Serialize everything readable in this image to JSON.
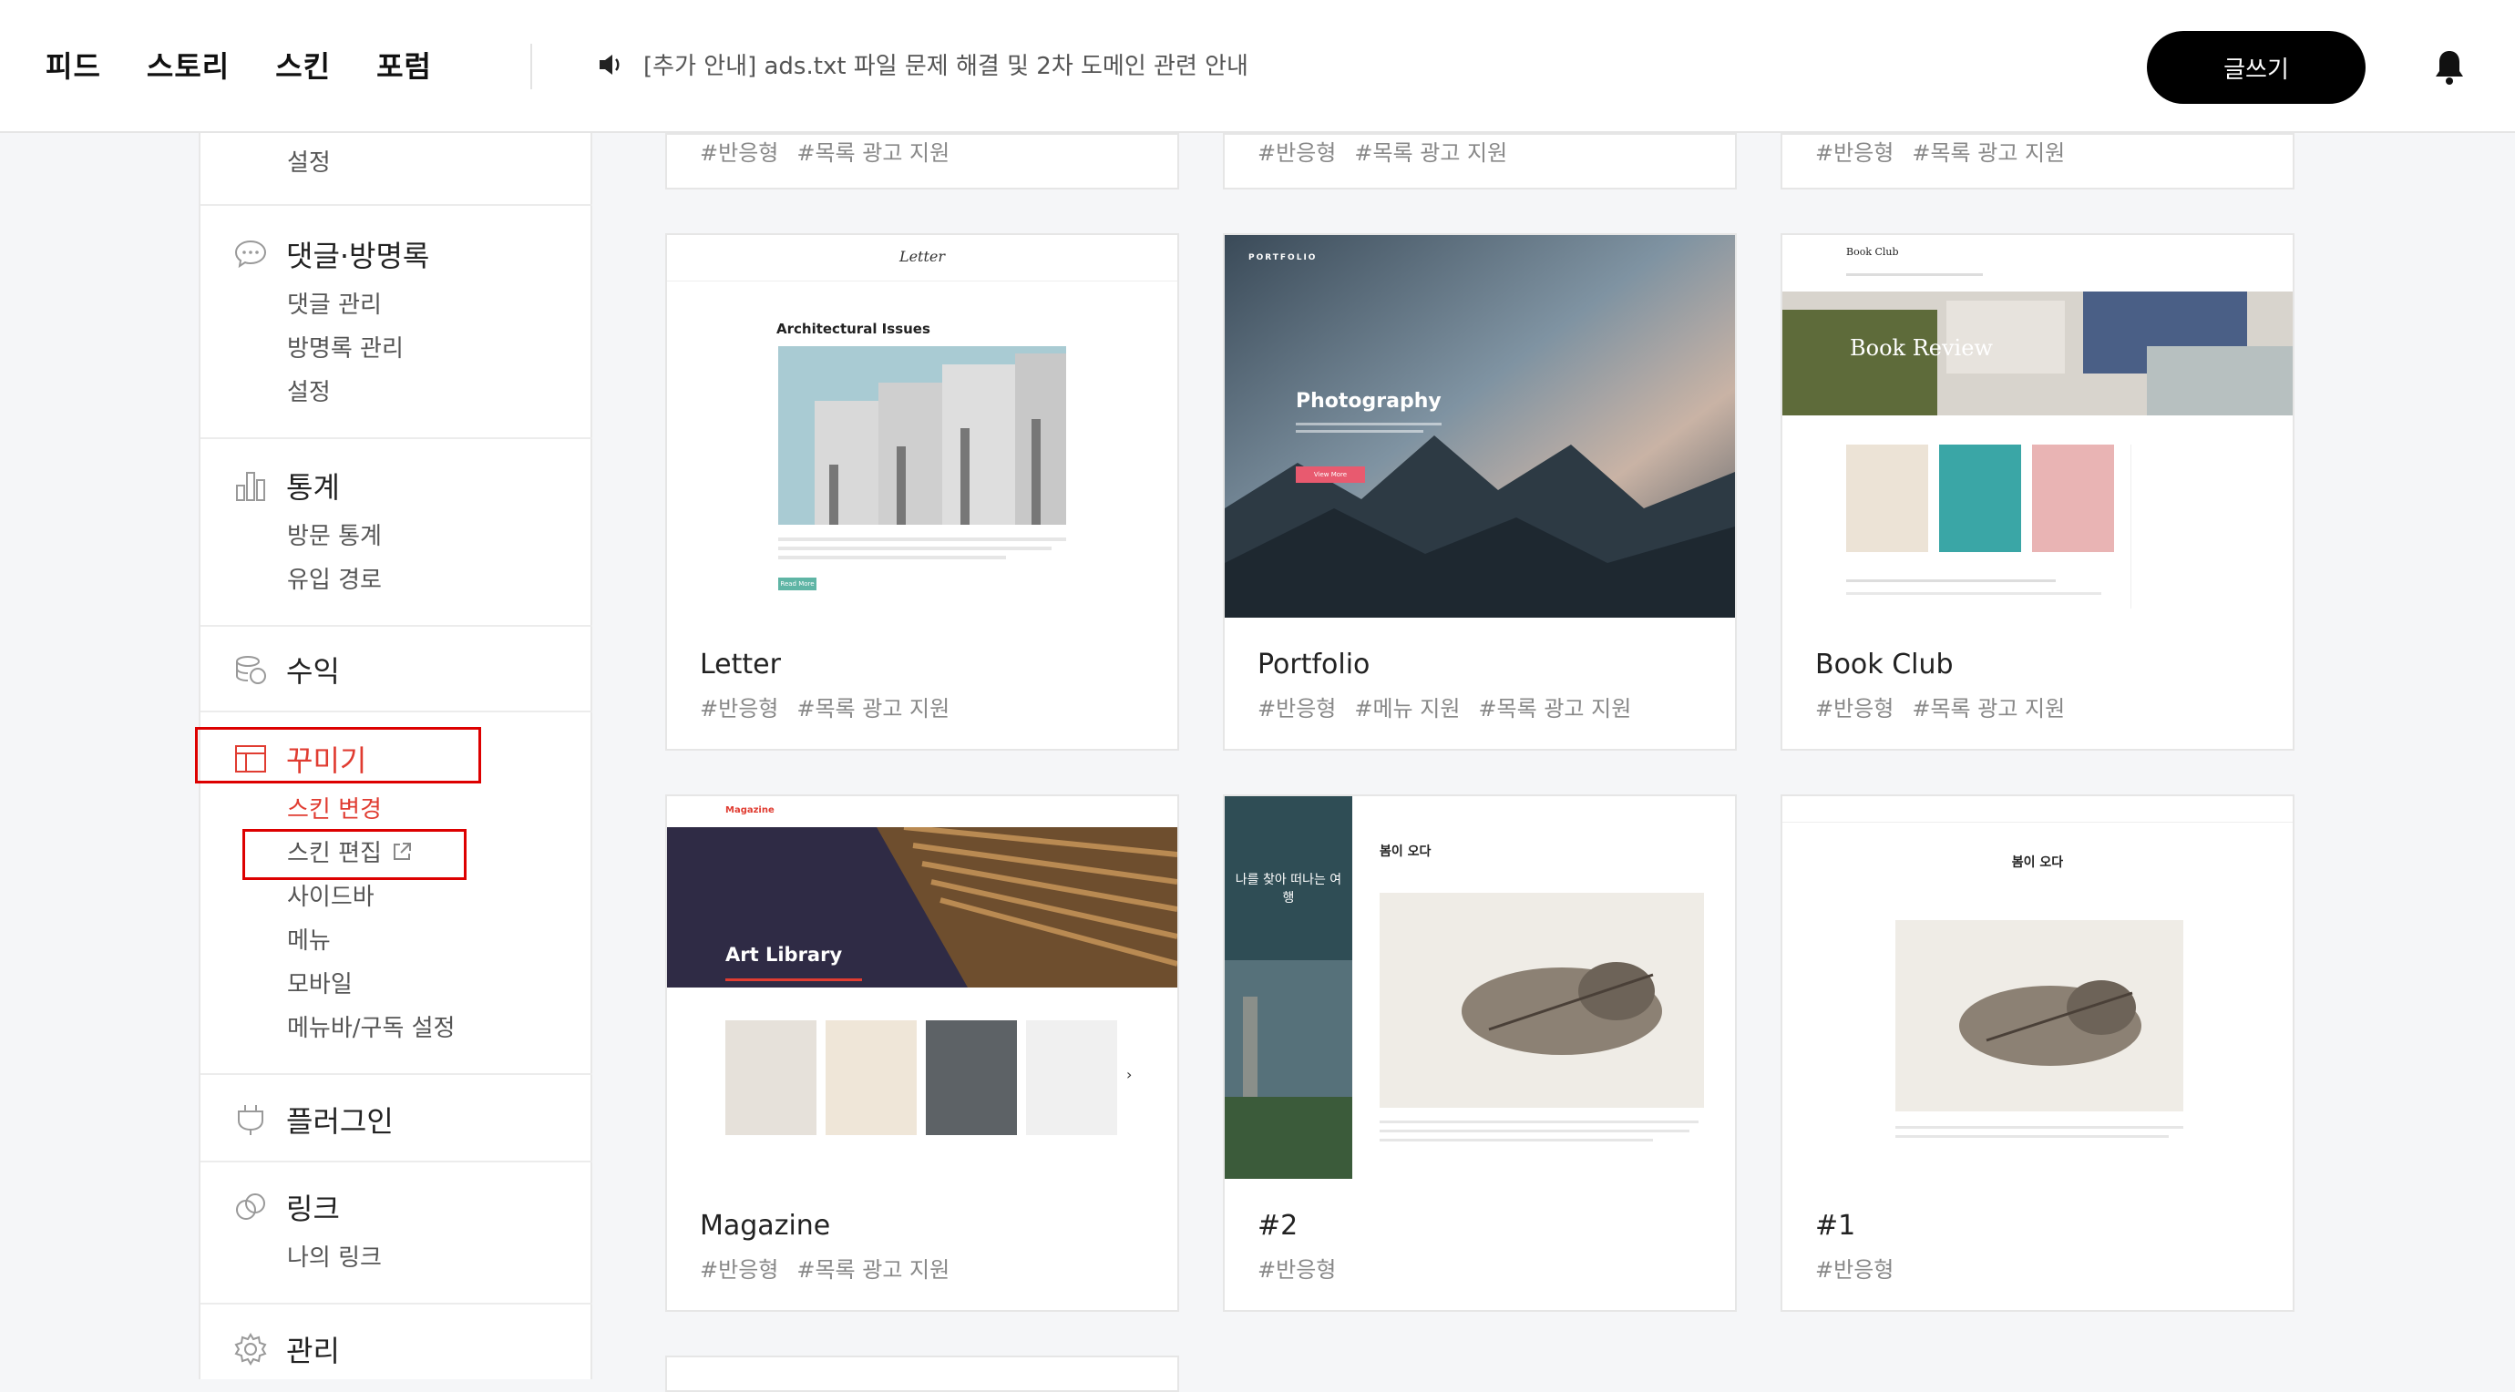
{
  "topbar": {
    "nav": [
      "피드",
      "스토리",
      "스킨",
      "포럼"
    ],
    "notice": "[추가 안내] ads.txt 파일 문제 해결 및 2차 도메인 관련 안내",
    "write_label": "글쓰기",
    "notice_icon": "speaker-icon",
    "bell_icon": "bell-icon"
  },
  "sidebar": {
    "top_setting": "설정",
    "comments": {
      "title": "댓글·방명록",
      "items": [
        "댓글 관리",
        "방명록 관리",
        "설정"
      ],
      "icon": "comment-icon"
    },
    "stats": {
      "title": "통계",
      "items": [
        "방문 통계",
        "유입 경로"
      ],
      "icon": "bar-chart-icon"
    },
    "revenue": {
      "title": "수익",
      "icon": "coins-icon"
    },
    "decorate": {
      "title": "꾸미기",
      "items": [
        "스킨 변경",
        "스킨 편집",
        "사이드바",
        "메뉴",
        "모바일",
        "메뉴바/구독 설정"
      ],
      "icon": "layout-icon"
    },
    "plugin": {
      "title": "플러그인",
      "icon": "plug-icon"
    },
    "link": {
      "title": "링크",
      "items": [
        "나의 링크"
      ],
      "icon": "link-icon"
    },
    "manage": {
      "title": "관리",
      "icon": "gear-icon"
    }
  },
  "colors": {
    "accent": "#e03c31",
    "annotation_red": "#dd0000"
  },
  "cards_top": [
    {
      "tags": [
        "#반응형",
        "#목록 광고 지원"
      ]
    },
    {
      "tags": [
        "#반응형",
        "#목록 광고 지원"
      ]
    },
    {
      "tags": [
        "#반응형",
        "#목록 광고 지원"
      ]
    }
  ],
  "cards": [
    {
      "name": "Letter",
      "tags": [
        "#반응형",
        "#목록 광고 지원"
      ],
      "preview": {
        "logo": "Letter",
        "subtitle": "Architectural Issues",
        "button": "Read More"
      }
    },
    {
      "name": "Portfolio",
      "tags": [
        "#반응형",
        "#메뉴 지원",
        "#목록 광고 지원"
      ],
      "preview": {
        "logo": "PORTFOLIO",
        "headline": "Photography",
        "button": "View More"
      }
    },
    {
      "name": "Book Club",
      "tags": [
        "#반응형",
        "#목록 광고 지원"
      ],
      "preview": {
        "logo": "Book Club",
        "banner": "Book Review"
      }
    },
    {
      "name": "Magazine",
      "tags": [
        "#반응형",
        "#목록 광고 지원"
      ],
      "preview": {
        "logo": "Magazine",
        "banner": "Art Library"
      }
    },
    {
      "name": "#2",
      "tags": [
        "#반응형"
      ],
      "preview": {
        "side_title": "나를 찾아 떠나는 여행",
        "post_title": "봄이 오다"
      }
    },
    {
      "name": "#1",
      "tags": [
        "#반응형"
      ],
      "preview": {
        "post_title": "봄이 오다"
      }
    }
  ]
}
